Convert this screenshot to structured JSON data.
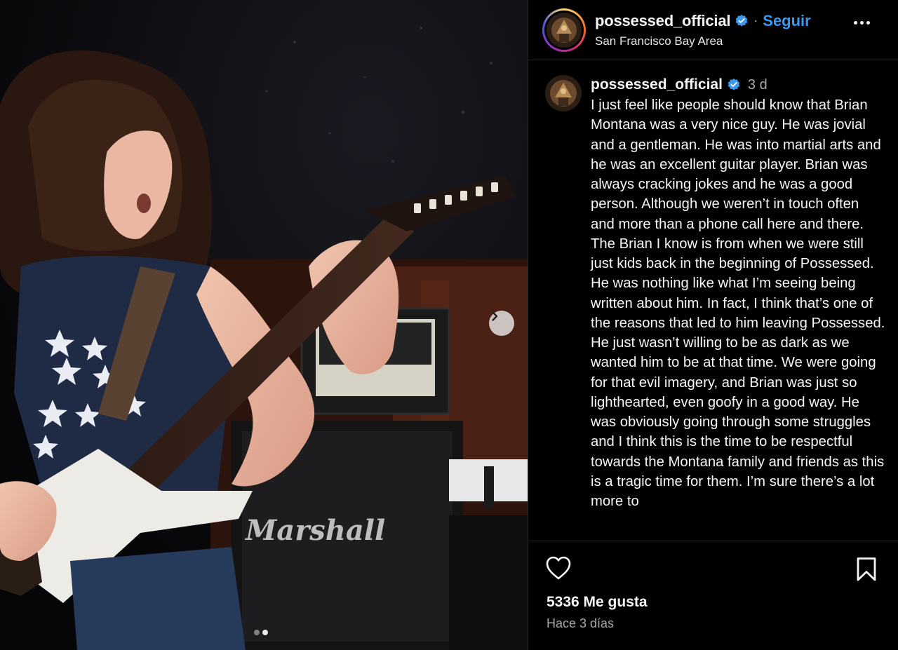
{
  "post": {
    "username": "possessed_official",
    "follow_label": "Seguir",
    "separator": "·",
    "location": "San Francisco Bay Area",
    "verified_icon": "verified-badge-icon",
    "accent_color": "#3b98f0"
  },
  "photo": {
    "amp_brand_text": "Marshall",
    "carousel_total": 2,
    "carousel_index": 2
  },
  "caption": {
    "username": "possessed_official",
    "time": "3 d",
    "text": "I just feel like people should know that Brian Montana was a very nice guy. He was jovial and a gentleman. He was into martial arts and he was an excellent guitar player. Brian was always cracking jokes and he was a good person. Although we weren’t in touch often and more than a phone call here and there. The Brian I know is from when we were still just kids back in the beginning of Possessed. He was nothing like what I’m seeing being written about him. In fact, I think that’s one of the reasons that led to him leaving Possessed. He just wasn’t willing to be as dark as we wanted him to be at that time. We were going for that evil imagery, and Brian was just so lighthearted, even goofy in a good way. He was obviously going through some struggles and I think this is the time to be respectful towards the Montana family and friends as this is a tragic time for them. I’m sure there’s a lot more to"
  },
  "stats": {
    "likes": "5336 Me gusta",
    "posted_ago": "Hace 3 días"
  }
}
